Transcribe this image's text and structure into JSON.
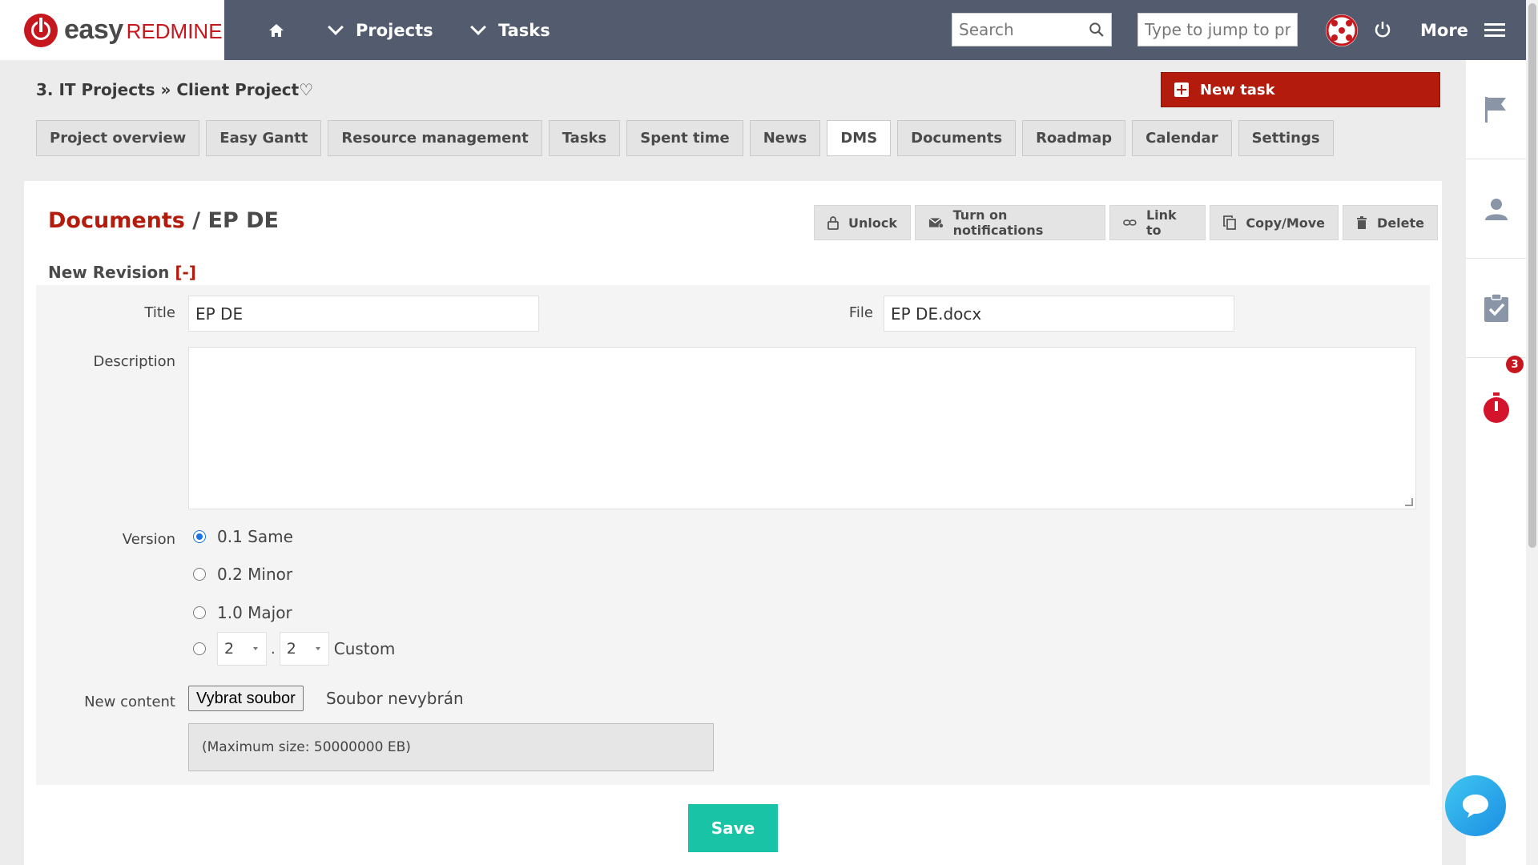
{
  "header": {
    "logo_easy": "easy",
    "logo_redmine": "REDMINE",
    "nav": {
      "projects": "Projects",
      "tasks": "Tasks",
      "more": "More"
    },
    "search_placeholder": "Search",
    "jump_placeholder": "Type to jump to pro"
  },
  "breadcrumb": "3. IT Projects » Client Project♡",
  "new_task_label": "New task",
  "tabs": [
    {
      "label": "Project overview",
      "active": false
    },
    {
      "label": "Easy Gantt",
      "active": false
    },
    {
      "label": "Resource management",
      "active": false
    },
    {
      "label": "Tasks",
      "active": false
    },
    {
      "label": "Spent time",
      "active": false
    },
    {
      "label": "News",
      "active": false
    },
    {
      "label": "DMS",
      "active": true
    },
    {
      "label": "Documents",
      "active": false
    },
    {
      "label": "Roadmap",
      "active": false
    },
    {
      "label": "Calendar",
      "active": false
    },
    {
      "label": "Settings",
      "active": false
    }
  ],
  "page": {
    "title_link": "Documents",
    "title_sep": " / ",
    "title_rest": "EP DE",
    "actions": {
      "unlock": "Unlock",
      "notifications": "Turn on notifications",
      "link_to": "Link to",
      "copy_move": "Copy/Move",
      "delete": "Delete"
    },
    "section": "New Revision",
    "section_toggle": "[-]"
  },
  "form": {
    "title_label": "Title",
    "title_value": "EP DE",
    "file_label": "File",
    "file_value": "EP DE.docx",
    "description_label": "Description",
    "version_label": "Version",
    "versions": [
      "0.1 Same",
      "0.2 Minor",
      "1.0 Major"
    ],
    "custom_major": "2",
    "custom_minor": "2",
    "custom_label": "Custom",
    "new_content_label": "New content",
    "choose_file": "Vybrat soubor",
    "no_file": "Soubor nevybrán",
    "max_size": "(Maximum size: 50000000 EB)",
    "save": "Save"
  },
  "sidebar": {
    "timer_badge": "3"
  },
  "colors": {
    "brand_red": "#b31b0c",
    "header_bg": "#535b6e",
    "save_green": "#19c3a6"
  }
}
